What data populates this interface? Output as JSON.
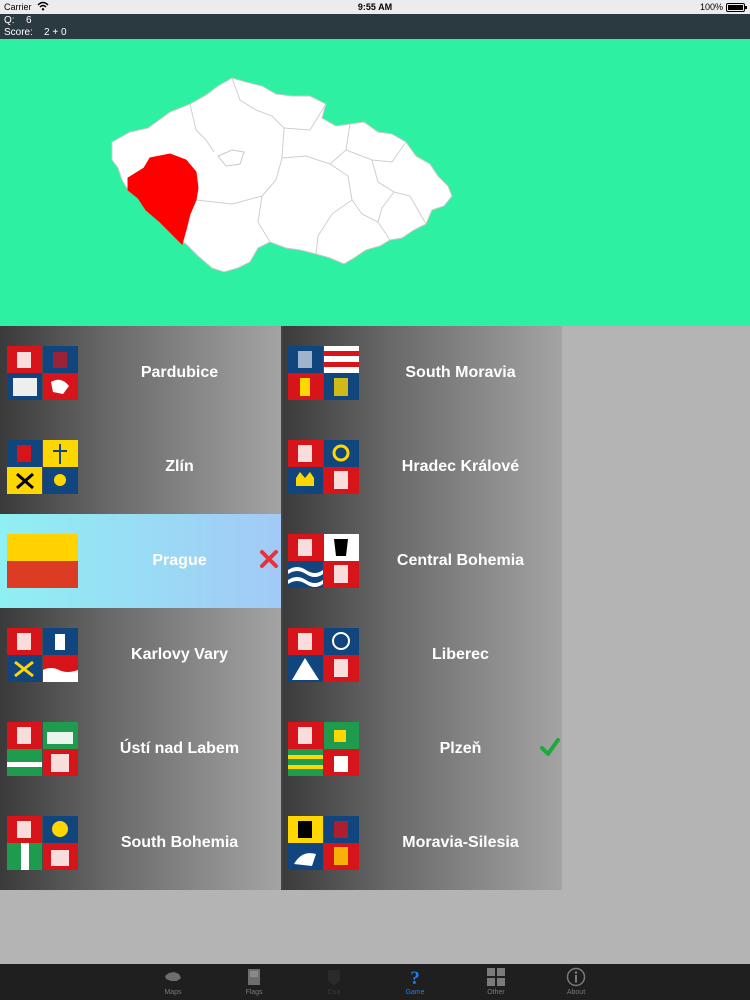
{
  "status_bar": {
    "carrier": "Carrier",
    "time": "9:55 AM",
    "battery": "100%"
  },
  "info": {
    "q_label": "Q:",
    "q_value": "6",
    "score_label": "Score:",
    "score_value": "2 + 0"
  },
  "map": {
    "highlighted_region": "Plzeň",
    "highlight_color": "#ff0000",
    "background_color": "#2ef0a3"
  },
  "answers": {
    "left": [
      {
        "label": "Pardubice"
      },
      {
        "label": "Zlín"
      },
      {
        "label": "Prague",
        "mark": "wrong"
      },
      {
        "label": "Karlovy Vary"
      },
      {
        "label": "Ústí nad Labem"
      },
      {
        "label": "South Bohemia"
      }
    ],
    "right": [
      {
        "label": "South Moravia"
      },
      {
        "label": "Hradec Králové"
      },
      {
        "label": "Central Bohemia"
      },
      {
        "label": "Liberec"
      },
      {
        "label": "Plzeň",
        "mark": "correct"
      },
      {
        "label": "Moravia-Silesia"
      }
    ]
  },
  "tabs": [
    {
      "label": "Maps",
      "icon": "map-icon"
    },
    {
      "label": "Flags",
      "icon": "flag-icon"
    },
    {
      "label": "Coa",
      "icon": "coat-of-arms-icon"
    },
    {
      "label": "Game",
      "icon": "question-icon",
      "active": true
    },
    {
      "label": "Other",
      "icon": "grid-icon"
    },
    {
      "label": "About",
      "icon": "info-icon"
    }
  ],
  "colors": {
    "active_tab": "#1a7df0",
    "wrong": "#e8323a",
    "correct": "#1fa83b"
  }
}
